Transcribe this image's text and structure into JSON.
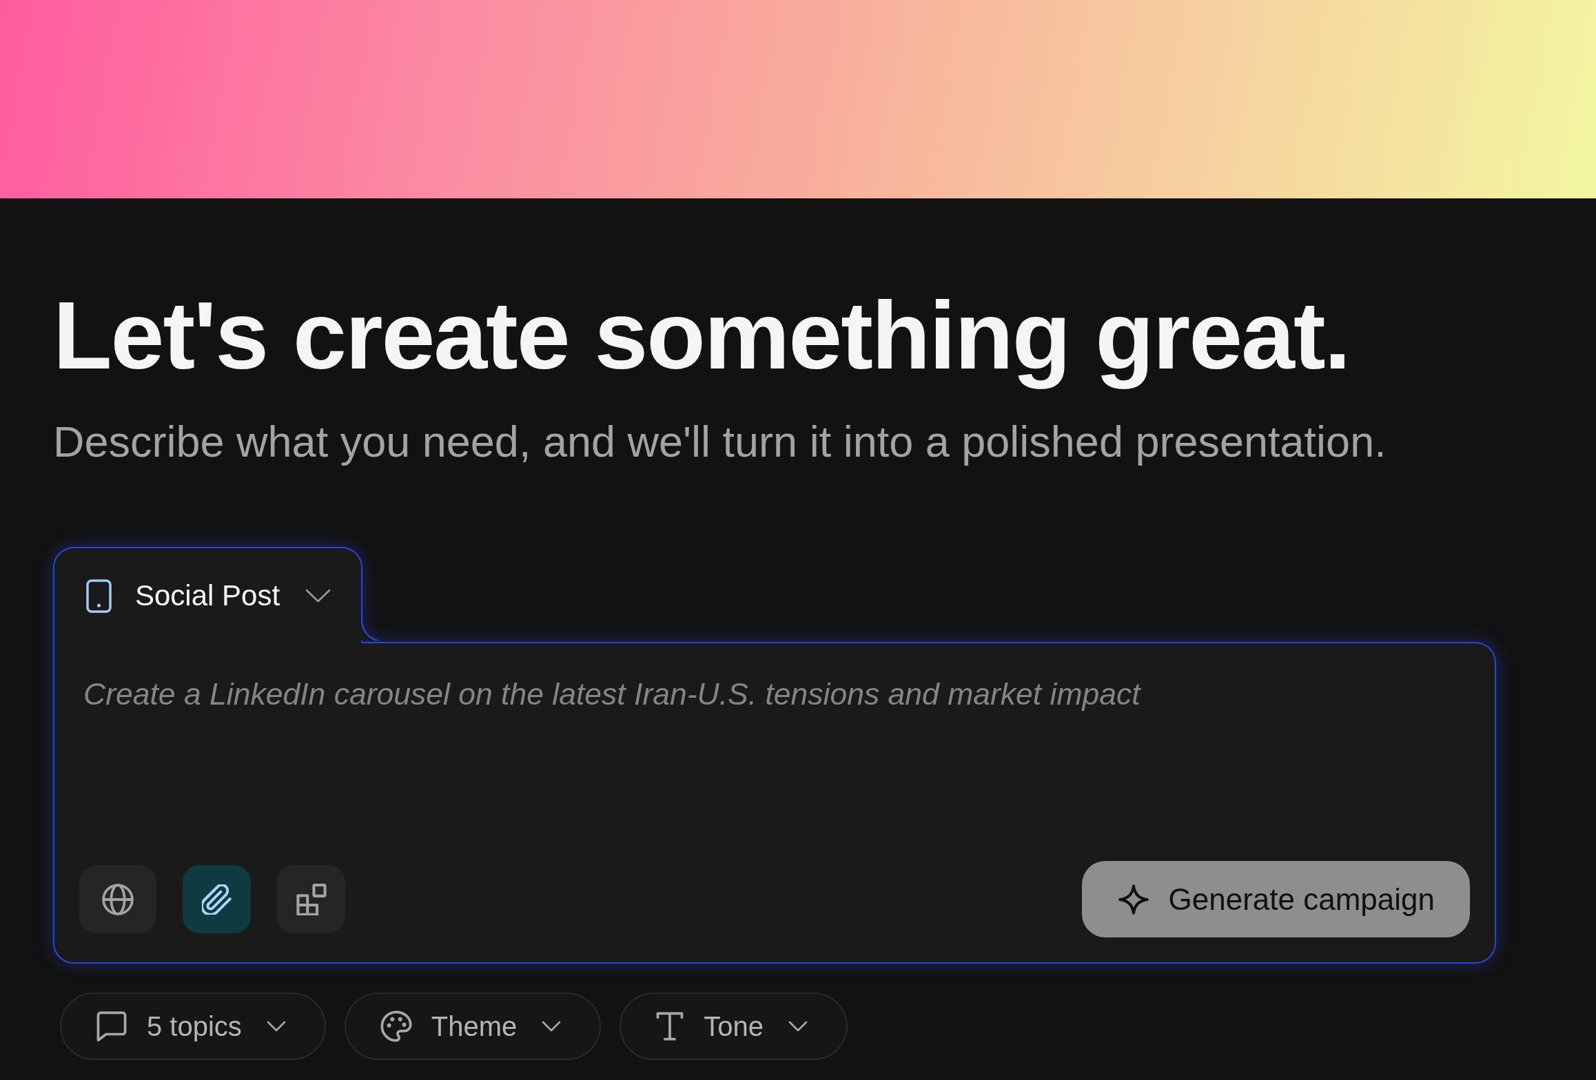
{
  "hero": {
    "title": "Let's create something great.",
    "subtitle": "Describe what you need, and we'll turn it into a polished presentation."
  },
  "composer": {
    "format": {
      "label": "Social Post"
    },
    "prompt": {
      "placeholder": "Create a LinkedIn carousel on the latest Iran-U.S. tensions and market impact"
    },
    "tool_buttons": [
      {
        "on": false
      },
      {
        "on": true
      },
      {
        "on": false
      }
    ],
    "submit": {
      "label": "Generate campaign"
    }
  },
  "options": [
    {
      "label": "5 topics"
    },
    {
      "label": "Theme"
    },
    {
      "label": "Tone"
    }
  ]
}
